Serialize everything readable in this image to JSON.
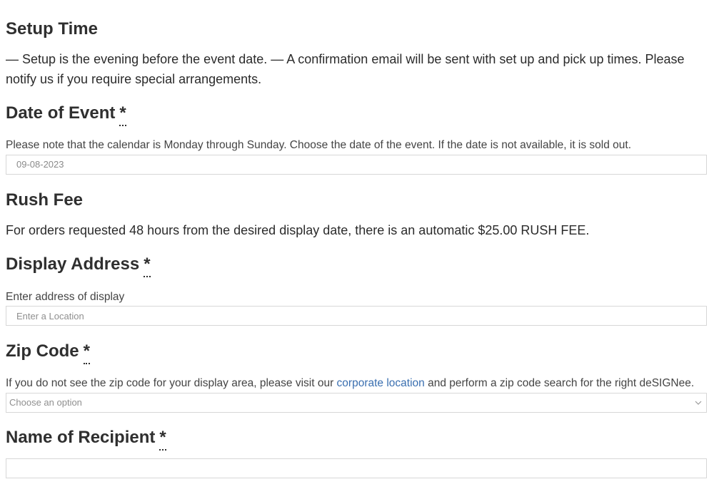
{
  "setup_time": {
    "heading": "Setup Time",
    "text": "— Setup is the evening before the event date. — A confirmation email will be sent with set up and pick up times. Please notify us if you require special arrangements."
  },
  "date_of_event": {
    "heading": "Date of Event",
    "required_mark": "*",
    "description": "Please note that the calendar is Monday through Sunday. Choose the date of the event. If the date is not available, it is sold out.",
    "value": "09-08-2023"
  },
  "rush_fee": {
    "heading": "Rush Fee",
    "text": "For orders requested 48 hours from the desired display date, there is an automatic $25.00 RUSH FEE."
  },
  "display_address": {
    "heading": "Display Address",
    "required_mark": "*",
    "description": "Enter address of display",
    "placeholder": "Enter a Location"
  },
  "zip_code": {
    "heading": "Zip Code",
    "required_mark": "*",
    "description_before_link": "If you do not see the zip code for your display area, please visit our ",
    "link_text": "corporate location",
    "description_after_link": " and perform a zip code search for the right deSIGNee.",
    "select_placeholder": "Choose an option",
    "chevron_icon": "chevron-down-icon"
  },
  "name_of_recipient": {
    "heading": "Name of Recipient",
    "required_mark": "*",
    "value": ""
  },
  "colors": {
    "text": "#2b2b2b",
    "link": "#3a6fb0",
    "border": "#d7d7d7",
    "placeholder": "#8f8f8f"
  }
}
